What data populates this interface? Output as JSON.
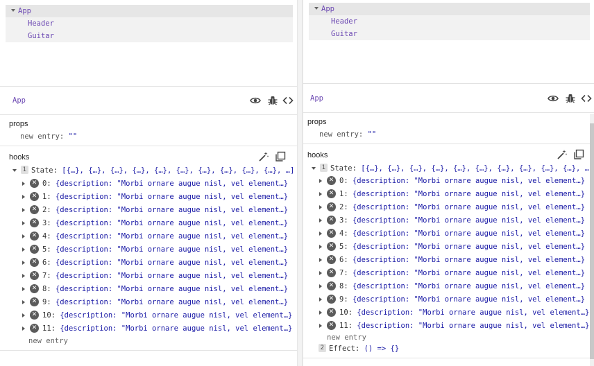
{
  "colors": {
    "component": "#6d4ab3",
    "value": "#1a1aa6",
    "badge": "#5b5b5b"
  },
  "left": {
    "tree": [
      {
        "label": "App",
        "expanded": true,
        "selected": true
      },
      {
        "label": "Header"
      },
      {
        "label": "Guitar"
      }
    ],
    "selected_component": "App",
    "toolbar_icons": [
      "eye-icon",
      "bug-icon",
      "code-icon"
    ],
    "props": {
      "title": "props",
      "new_entry_key": "new entry",
      "new_entry_value": "\"\""
    },
    "hooks": {
      "title": "hooks",
      "state_index": "1",
      "state_label": "State:",
      "state_value": "[{…}, {…}, {…}, {…}, {…}, {…}, {…}, {…}, {…}, {…}, …]",
      "items": [
        {
          "index": "0:",
          "value": "{description: \"Morbi ornare augue nisl, vel element…}"
        },
        {
          "index": "1:",
          "value": "{description: \"Morbi ornare augue nisl, vel element…}"
        },
        {
          "index": "2:",
          "value": "{description: \"Morbi ornare augue nisl, vel element…}"
        },
        {
          "index": "3:",
          "value": "{description: \"Morbi ornare augue nisl, vel element…}"
        },
        {
          "index": "4:",
          "value": "{description: \"Morbi ornare augue nisl, vel element…}"
        },
        {
          "index": "5:",
          "value": "{description: \"Morbi ornare augue nisl, vel element…}"
        },
        {
          "index": "6:",
          "value": "{description: \"Morbi ornare augue nisl, vel element…}"
        },
        {
          "index": "7:",
          "value": "{description: \"Morbi ornare augue nisl, vel element…}"
        },
        {
          "index": "8:",
          "value": "{description: \"Morbi ornare augue nisl, vel element…}"
        },
        {
          "index": "9:",
          "value": "{description: \"Morbi ornare augue nisl, vel element…}"
        },
        {
          "index": "10:",
          "value": "{description: \"Morbi ornare augue nisl, vel element…}"
        },
        {
          "index": "11:",
          "value": "{description: \"Morbi ornare augue nisl, vel element…}"
        }
      ],
      "new_entry": "new entry"
    }
  },
  "right": {
    "tree": [
      {
        "label": "App",
        "expanded": true,
        "selected": true
      },
      {
        "label": "Header"
      },
      {
        "label": "Guitar"
      }
    ],
    "selected_component": "App",
    "props": {
      "title": "props",
      "new_entry_key": "new entry",
      "new_entry_value": "\"\""
    },
    "hooks": {
      "title": "hooks",
      "state_index": "1",
      "state_label": "State:",
      "state_value": "[{…}, {…}, {…}, {…}, {…}, {…}, {…}, {…}, {…}, {…}, …]",
      "items": [
        {
          "index": "0:",
          "value": "{description: \"Morbi ornare augue nisl, vel element…}"
        },
        {
          "index": "1:",
          "value": "{description: \"Morbi ornare augue nisl, vel element…}"
        },
        {
          "index": "2:",
          "value": "{description: \"Morbi ornare augue nisl, vel element…}"
        },
        {
          "index": "3:",
          "value": "{description: \"Morbi ornare augue nisl, vel element…}"
        },
        {
          "index": "4:",
          "value": "{description: \"Morbi ornare augue nisl, vel element…}"
        },
        {
          "index": "5:",
          "value": "{description: \"Morbi ornare augue nisl, vel element…}"
        },
        {
          "index": "6:",
          "value": "{description: \"Morbi ornare augue nisl, vel element…}"
        },
        {
          "index": "7:",
          "value": "{description: \"Morbi ornare augue nisl, vel element…}"
        },
        {
          "index": "8:",
          "value": "{description: \"Morbi ornare augue nisl, vel element…}"
        },
        {
          "index": "9:",
          "value": "{description: \"Morbi ornare augue nisl, vel element…}"
        },
        {
          "index": "10:",
          "value": "{description: \"Morbi ornare augue nisl, vel element…}"
        },
        {
          "index": "11:",
          "value": "{description: \"Morbi ornare augue nisl, vel element…}"
        }
      ],
      "new_entry": "new entry",
      "effect_index": "2",
      "effect_label": "Effect:",
      "effect_value": "() => {}"
    }
  }
}
